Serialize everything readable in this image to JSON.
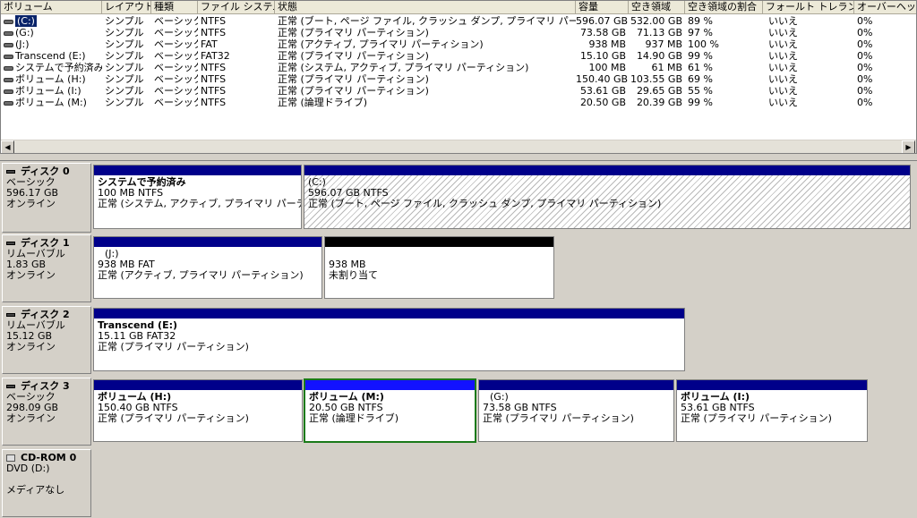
{
  "columns": [
    "ボリューム",
    "レイアウト",
    "種類",
    "ファイル システム",
    "状態",
    "容量",
    "空き領域",
    "空き領域の割合",
    "フォールト トレランス",
    "オーバーヘッド"
  ],
  "volumes": [
    {
      "name": "(C:)",
      "layout": "シンプル",
      "type": "ベーシック",
      "fs": "NTFS",
      "status": "正常 (ブート, ページ ファイル, クラッシュ ダンプ, プライマリ パーティション)",
      "capacity": "596.07 GB",
      "free": "532.00 GB",
      "pct": "89 %",
      "ft": "いいえ",
      "overhead": "0%",
      "selected": true
    },
    {
      "name": "(G:)",
      "layout": "シンプル",
      "type": "ベーシック",
      "fs": "NTFS",
      "status": "正常 (プライマリ パーティション)",
      "capacity": "73.58 GB",
      "free": "71.13 GB",
      "pct": "97 %",
      "ft": "いいえ",
      "overhead": "0%"
    },
    {
      "name": "(J:)",
      "layout": "シンプル",
      "type": "ベーシック",
      "fs": "FAT",
      "status": "正常 (アクティブ, プライマリ パーティション)",
      "capacity": "938 MB",
      "free": "937 MB",
      "pct": "100 %",
      "ft": "いいえ",
      "overhead": "0%"
    },
    {
      "name": "Transcend (E:)",
      "layout": "シンプル",
      "type": "ベーシック",
      "fs": "FAT32",
      "status": "正常 (プライマリ パーティション)",
      "capacity": "15.10 GB",
      "free": "14.90 GB",
      "pct": "99 %",
      "ft": "いいえ",
      "overhead": "0%"
    },
    {
      "name": "システムで予約済み",
      "layout": "シンプル",
      "type": "ベーシック",
      "fs": "NTFS",
      "status": "正常 (システム, アクティブ, プライマリ パーティション)",
      "capacity": "100 MB",
      "free": "61 MB",
      "pct": "61 %",
      "ft": "いいえ",
      "overhead": "0%"
    },
    {
      "name": "ボリューム (H:)",
      "layout": "シンプル",
      "type": "ベーシック",
      "fs": "NTFS",
      "status": "正常 (プライマリ パーティション)",
      "capacity": "150.40 GB",
      "free": "103.55 GB",
      "pct": "69 %",
      "ft": "いいえ",
      "overhead": "0%"
    },
    {
      "name": "ボリューム (I:)",
      "layout": "シンプル",
      "type": "ベーシック",
      "fs": "NTFS",
      "status": "正常 (プライマリ パーティション)",
      "capacity": "53.61 GB",
      "free": "29.65 GB",
      "pct": "55 %",
      "ft": "いいえ",
      "overhead": "0%"
    },
    {
      "name": "ボリューム (M:)",
      "layout": "シンプル",
      "type": "ベーシック",
      "fs": "NTFS",
      "status": "正常 (論理ドライブ)",
      "capacity": "20.50 GB",
      "free": "20.39 GB",
      "pct": "99 %",
      "ft": "いいえ",
      "overhead": "0%"
    }
  ],
  "scroll": {
    "left": "◀",
    "right": "▶"
  },
  "disks": {
    "d0": {
      "name": "ディスク 0",
      "kind": "ベーシック",
      "size": "596.17 GB",
      "state": "オンライン",
      "p1": {
        "title": "システムで予約済み",
        "info": "100 MB NTFS",
        "status": "正常 (システム, アクティブ, プライマリ パーティション)"
      },
      "p2": {
        "title": "(C:)",
        "info": "596.07 GB NTFS",
        "status": "正常 (ブート, ページ ファイル, クラッシュ ダンプ, プライマリ パーティション)"
      }
    },
    "d1": {
      "name": "ディスク 1",
      "kind": "リムーバブル",
      "size": "1.83 GB",
      "state": "オンライン",
      "p1": {
        "title": "(J:)",
        "info": "938 MB FAT",
        "status": "正常 (アクティブ, プライマリ パーティション)"
      },
      "p2": {
        "info": "938 MB",
        "status": "未割り当て"
      }
    },
    "d2": {
      "name": "ディスク 2",
      "kind": "リムーバブル",
      "size": "15.12 GB",
      "state": "オンライン",
      "p1": {
        "title": "Transcend (E:)",
        "info": "15.11 GB FAT32",
        "status": "正常 (プライマリ パーティション)"
      }
    },
    "d3": {
      "name": "ディスク 3",
      "kind": "ベーシック",
      "size": "298.09 GB",
      "state": "オンライン",
      "p1": {
        "title": "ボリューム (H:)",
        "info": "150.40 GB NTFS",
        "status": "正常 (プライマリ パーティション)"
      },
      "p2": {
        "title": "ボリューム (M:)",
        "info": "20.50 GB NTFS",
        "status": "正常 (論理ドライブ)"
      },
      "p3": {
        "title": "(G:)",
        "info": "73.58 GB NTFS",
        "status": "正常 (プライマリ パーティション)"
      },
      "p4": {
        "title": "ボリューム (I:)",
        "info": "53.61 GB NTFS",
        "status": "正常 (プライマリ パーティション)"
      }
    },
    "cd0": {
      "name": "CD-ROM 0",
      "kind": "DVD (D:)",
      "media": "メディアなし"
    }
  }
}
